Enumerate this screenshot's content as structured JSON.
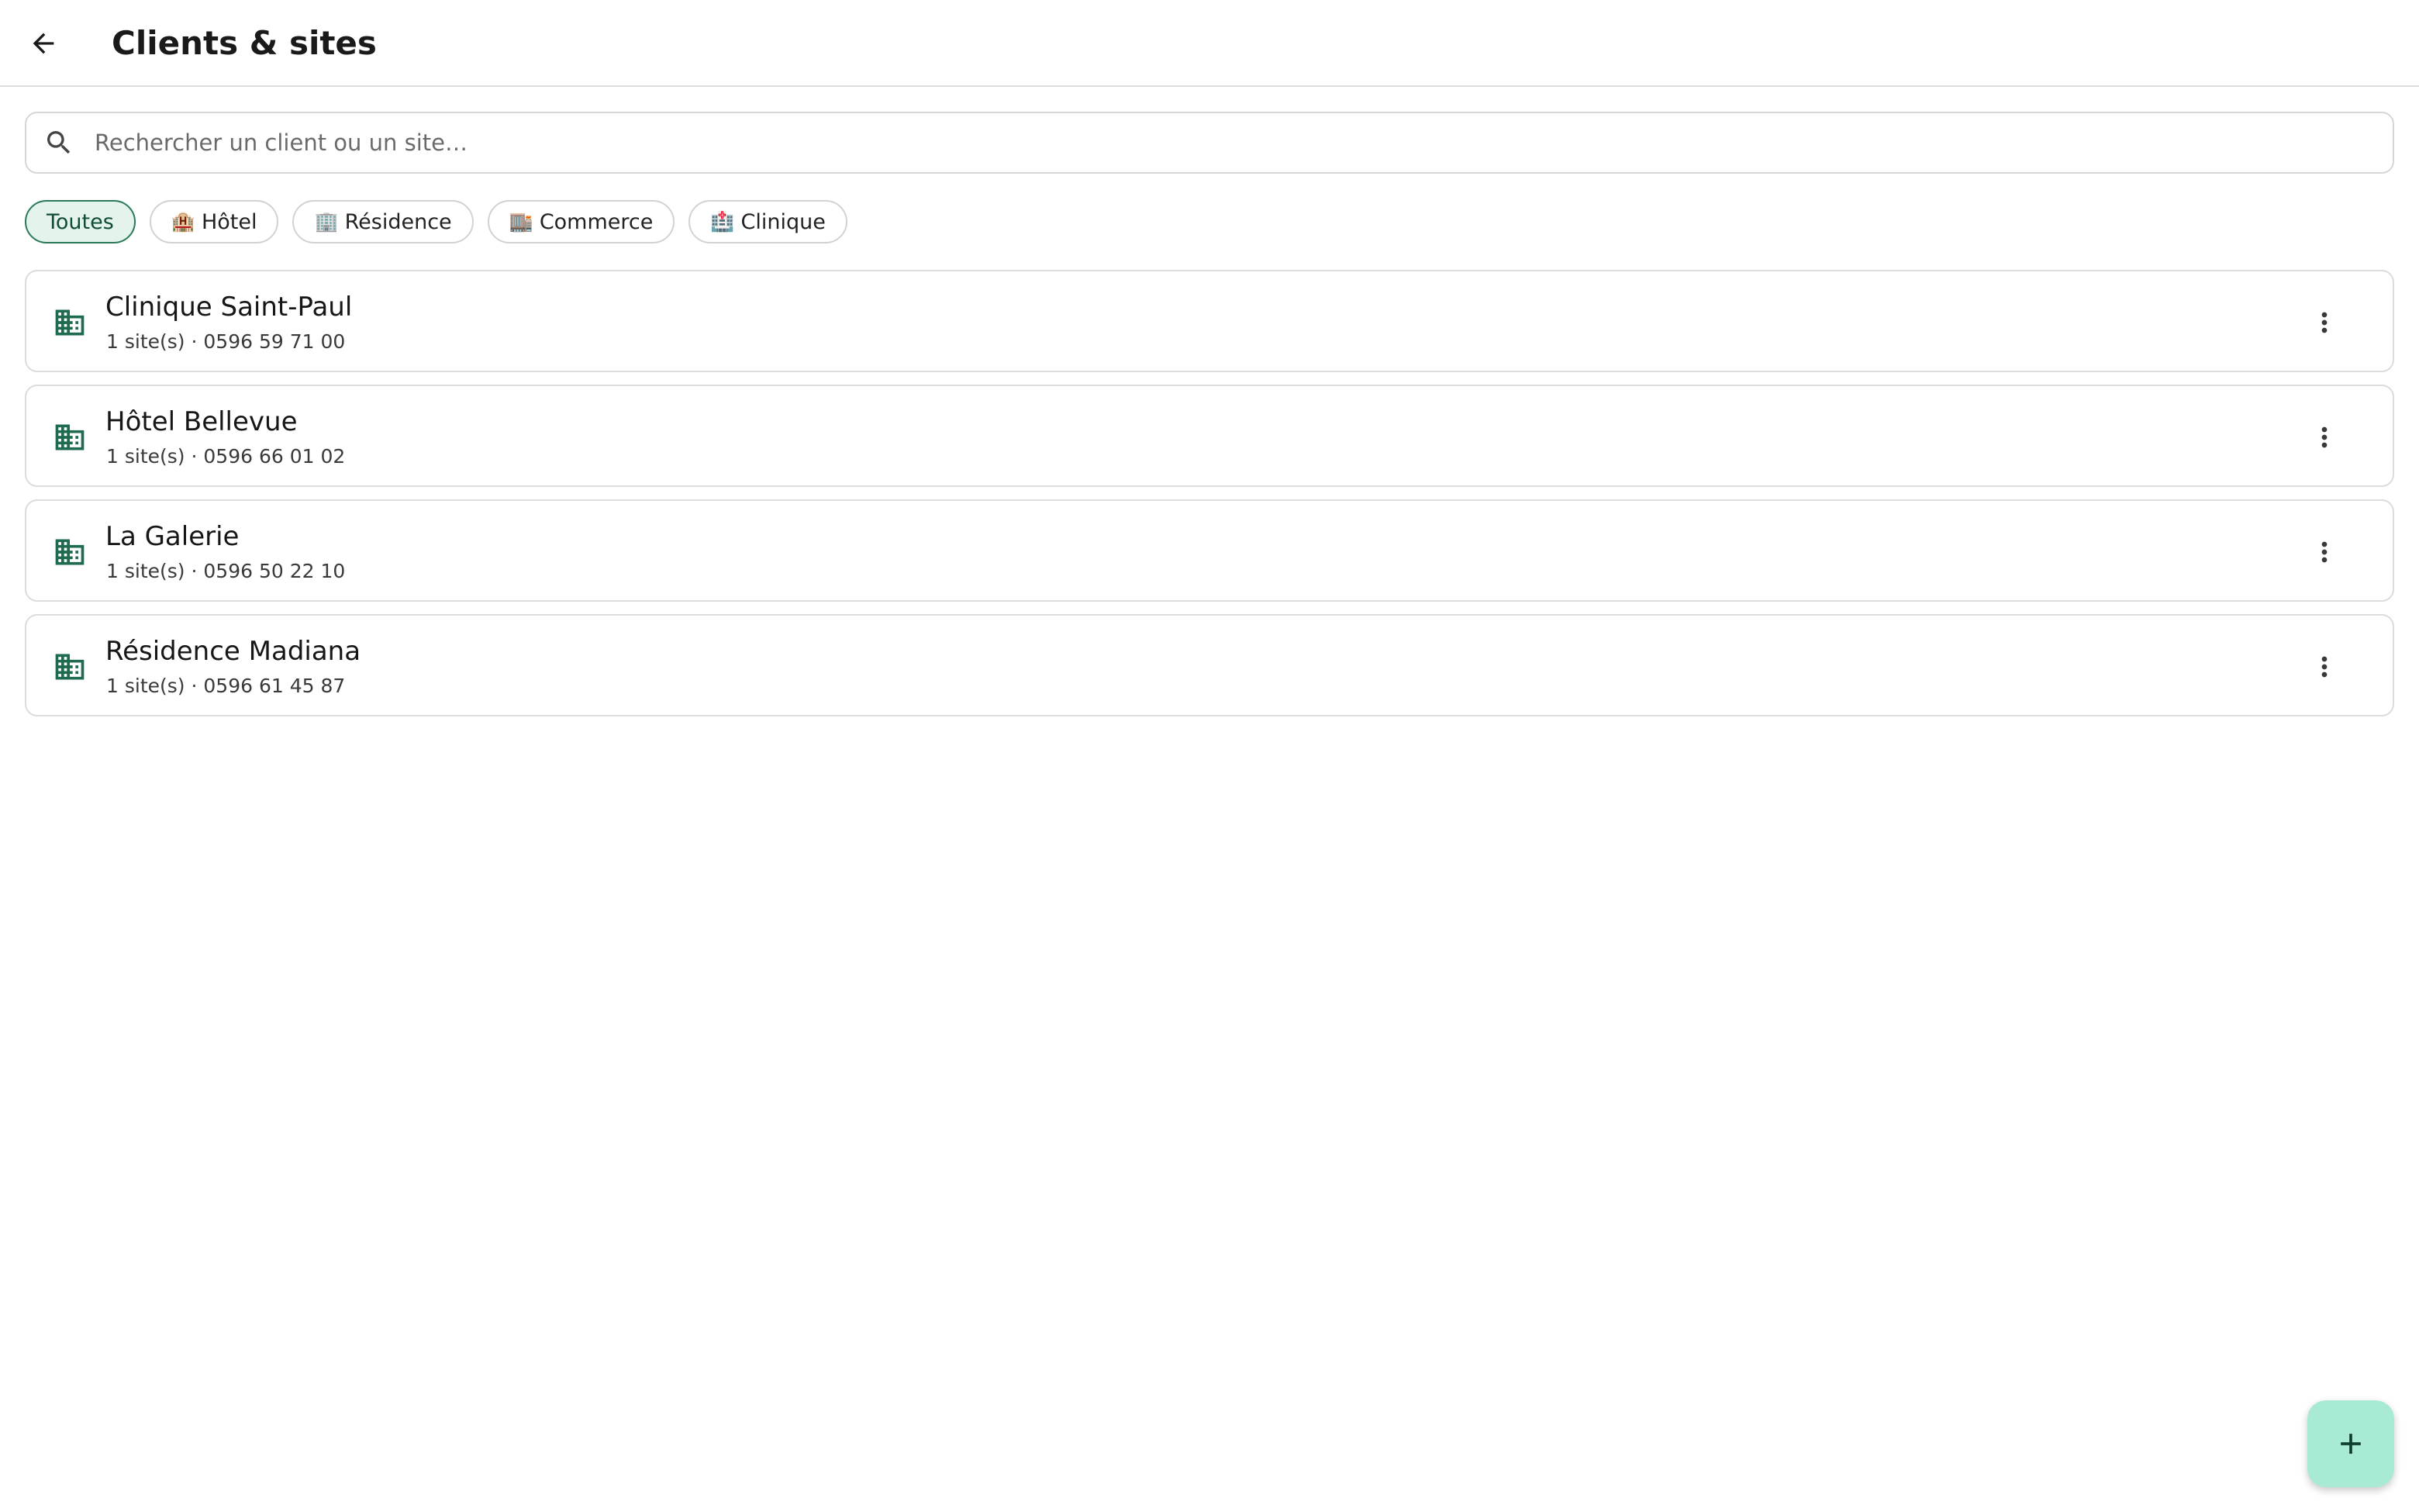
{
  "header": {
    "title": "Clients & sites",
    "back_icon": "arrow-back-icon"
  },
  "search": {
    "placeholder": "Rechercher un client ou un site…",
    "value": "",
    "icon": "search-icon"
  },
  "filters": [
    {
      "emoji": "",
      "label": "Toutes",
      "selected": true
    },
    {
      "emoji": "🏨",
      "label": "Hôtel",
      "selected": false
    },
    {
      "emoji": "🏢",
      "label": "Résidence",
      "selected": false
    },
    {
      "emoji": "🏬",
      "label": "Commerce",
      "selected": false
    },
    {
      "emoji": "🏥",
      "label": "Clinique",
      "selected": false
    }
  ],
  "clients": [
    {
      "name": "Clinique Saint-Paul",
      "meta": "1 site(s) · 0596 59 71 00"
    },
    {
      "name": "Hôtel Bellevue",
      "meta": "1 site(s) · 0596 66 01 02"
    },
    {
      "name": "La Galerie",
      "meta": "1 site(s) · 0596 50 22 10"
    },
    {
      "name": "Résidence Madiana",
      "meta": "1 site(s) · 0596 61 45 87"
    }
  ],
  "icons": {
    "client": "business-building-icon",
    "more": "more-vert-icon",
    "fab": "add-icon"
  },
  "colors": {
    "accent": "#1f6b4f",
    "chip_selected_bg": "#e4f3ec",
    "fab_bg": "#a9ead4"
  }
}
